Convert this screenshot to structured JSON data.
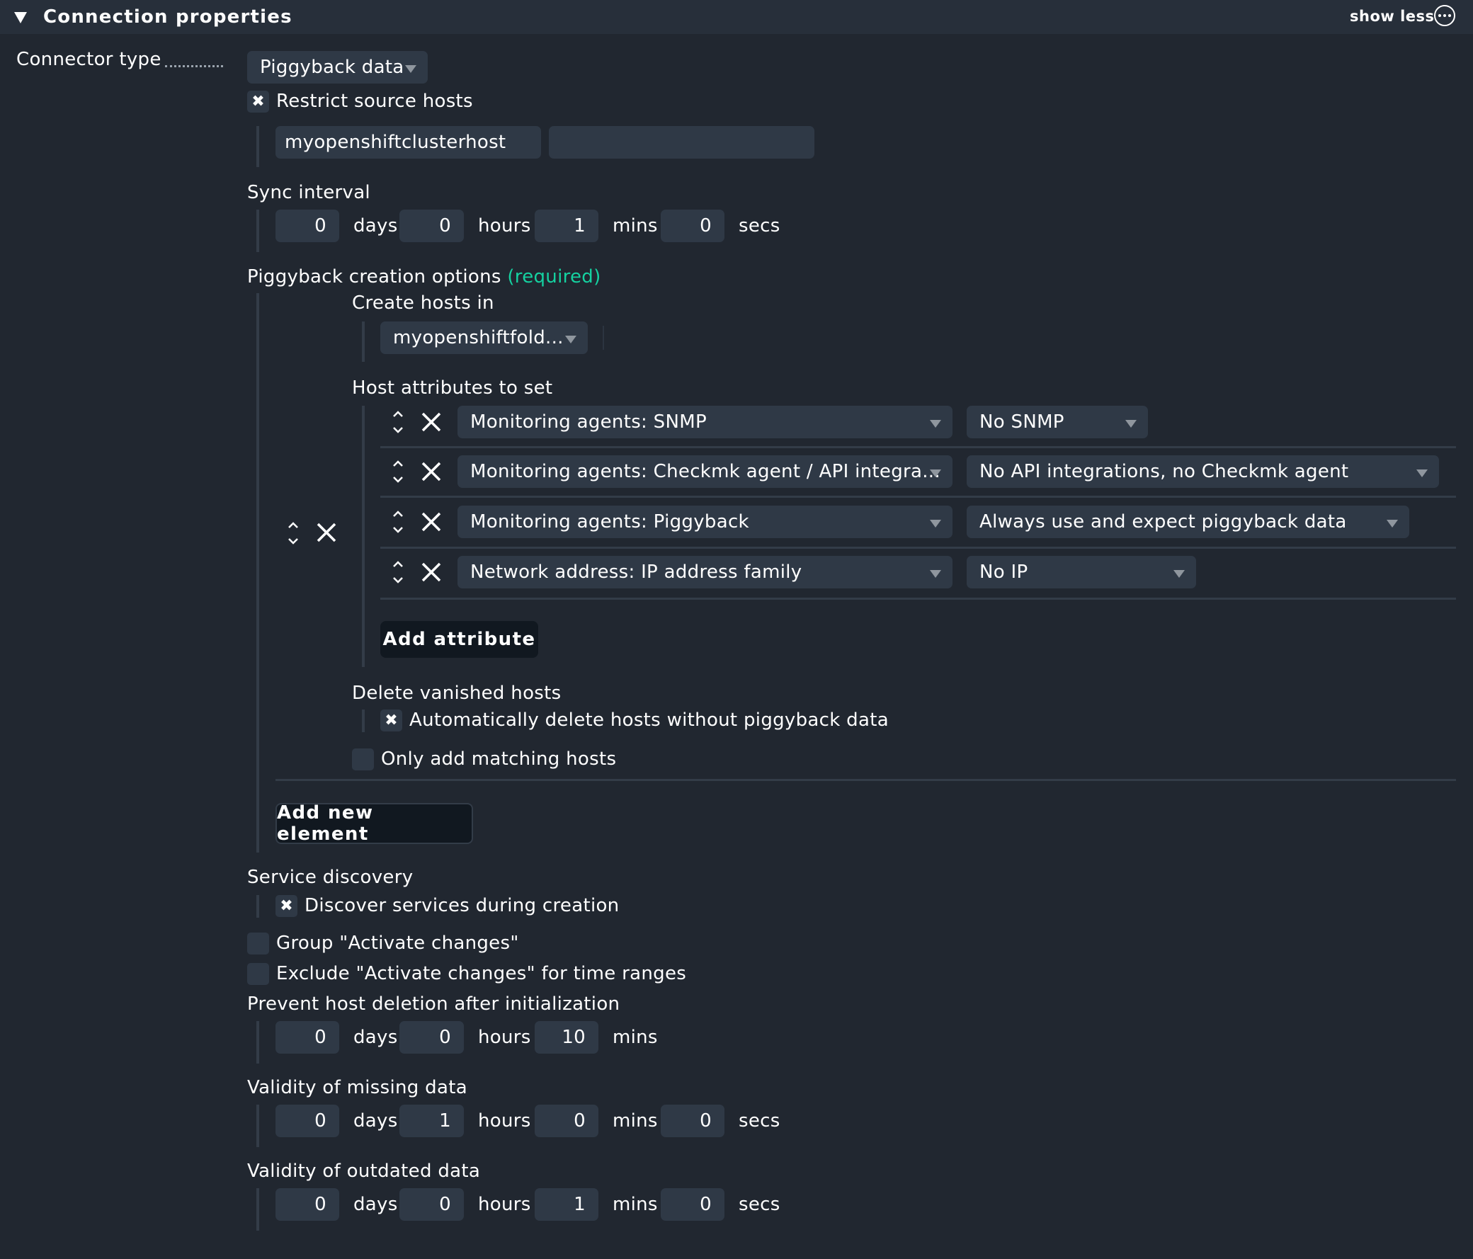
{
  "header": {
    "title": "Connection properties",
    "show_less": "show less",
    "more_icon": "ellipsis-circle-icon"
  },
  "connector_type": {
    "label": "Connector type",
    "value": "Piggyback data"
  },
  "restrict_source_hosts": {
    "label": "Restrict source hosts",
    "checked": true,
    "hosts": [
      "myopenshiftclusterhost",
      ""
    ]
  },
  "sync_interval": {
    "label": "Sync interval",
    "days": "0",
    "hours": "0",
    "mins": "1",
    "secs": "0"
  },
  "units": {
    "days": "days",
    "hours": "hours",
    "mins": "mins",
    "secs": "secs"
  },
  "piggyback_creation": {
    "label": "Piggyback creation options",
    "required": "(required)",
    "create_hosts_in": {
      "label": "Create hosts in",
      "value": "myopenshiftfold..."
    },
    "host_attributes": {
      "label": "Host attributes to set",
      "rows": [
        {
          "attribute": "Monitoring agents: SNMP",
          "value": "No SNMP"
        },
        {
          "attribute": "Monitoring agents: Checkmk agent / API integra...",
          "value": "No API integrations, no Checkmk agent"
        },
        {
          "attribute": "Monitoring agents: Piggyback",
          "value": "Always use and expect piggyback data"
        },
        {
          "attribute": "Network address: IP address family",
          "value": "No IP"
        }
      ],
      "add_attribute": "Add attribute"
    },
    "delete_vanished": {
      "label": "Delete vanished hosts",
      "option": "Automatically delete hosts without piggyback data",
      "checked": true
    },
    "only_add_matching": {
      "label": "Only add matching hosts",
      "checked": false
    },
    "add_new_element": "Add new element"
  },
  "service_discovery": {
    "label": "Service discovery",
    "option": "Discover services during creation",
    "checked": true
  },
  "group_activate": {
    "label": "Group \"Activate changes\"",
    "checked": false
  },
  "exclude_activate": {
    "label": "Exclude \"Activate changes\" for time ranges",
    "checked": false
  },
  "prevent_deletion": {
    "label": "Prevent host deletion after initialization",
    "days": "0",
    "hours": "0",
    "mins": "10"
  },
  "validity_missing": {
    "label": "Validity of missing data",
    "days": "0",
    "hours": "1",
    "mins": "0",
    "secs": "0"
  },
  "validity_outdated": {
    "label": "Validity of outdated data",
    "days": "0",
    "hours": "0",
    "mins": "1",
    "secs": "0"
  },
  "colors": {
    "background": "#212730",
    "header": "#272f3a",
    "field": "#2f3946",
    "required": "#15d1a0",
    "button": "#111820"
  }
}
